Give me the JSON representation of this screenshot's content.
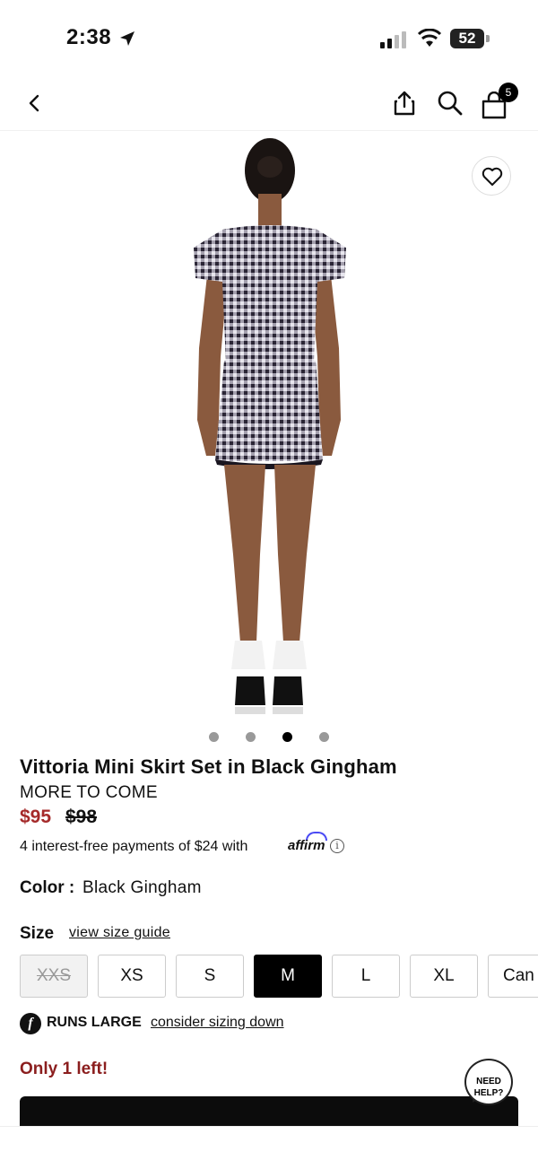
{
  "status_bar": {
    "time": "2:38",
    "battery": "52"
  },
  "nav": {
    "bag_count": "5"
  },
  "gallery": {
    "dot_count": 4,
    "active_index": 2
  },
  "product": {
    "title": "Vittoria Mini Skirt Set in Black Gingham",
    "collection": "MORE TO COME",
    "price_sale": "$95",
    "price_original": "$98",
    "installments": "4 interest-free payments of $24 with",
    "affirm_logo": "affirm",
    "color_label": "Color :",
    "color_value": "Black Gingham",
    "size_label": "Size",
    "size_guide_link": "view size guide",
    "sizes": [
      "XXS",
      "XS",
      "S",
      "M",
      "L",
      "XL",
      "Can"
    ],
    "fit_label": "RUNS LARGE",
    "fit_link": "consider sizing down",
    "stock_text": "Only 1 left!"
  },
  "help": {
    "label_line1": "NEED",
    "label_line2": "HELP?"
  },
  "colors": {
    "sale_red": "#a52a2a",
    "stock_red": "#8b1e1e",
    "affirm_blue": "#4a4af4"
  }
}
